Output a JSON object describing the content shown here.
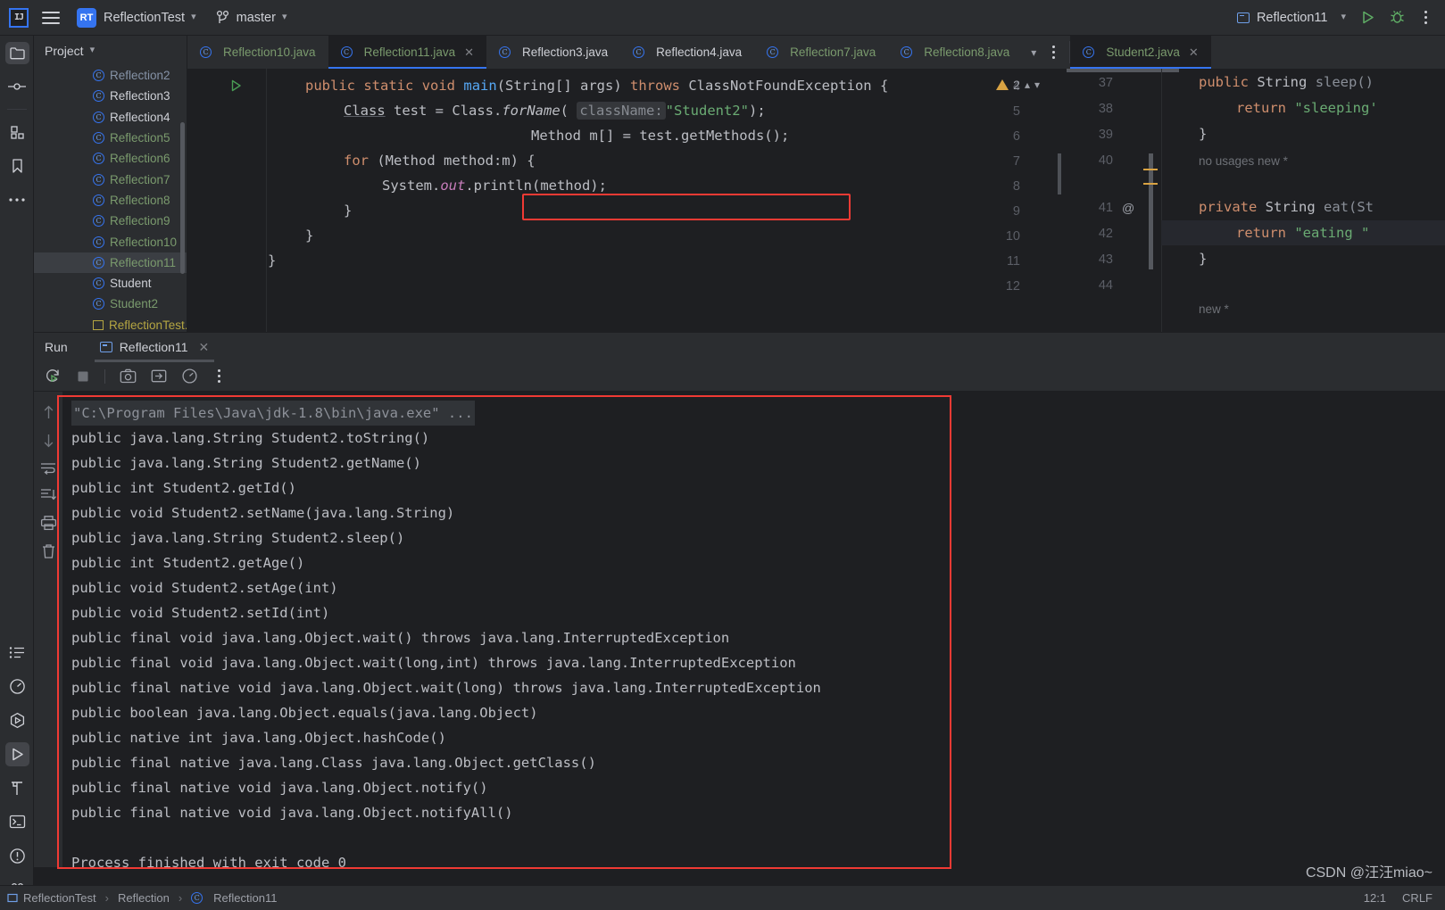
{
  "toolbar": {
    "logo_text": "IJ",
    "project_badge": "RT",
    "project_name": "ReflectionTest",
    "branch_name": "master",
    "run_config": "Reflection11",
    "icons": {
      "menu": "hamburger-icon",
      "run": "run-icon",
      "debug": "debug-icon",
      "more": "more-icon"
    }
  },
  "left_activity_bar": {
    "items": [
      {
        "name": "project-icon",
        "label": "Project"
      },
      {
        "name": "commit-icon",
        "label": "Commit"
      },
      {
        "name": "structure-icon",
        "label": "Structure"
      },
      {
        "name": "bookmarks-icon",
        "label": "Bookmarks"
      },
      {
        "name": "more-tool-windows-icon",
        "label": "More"
      }
    ],
    "bottom_items": [
      {
        "name": "todo-icon",
        "label": "TODO"
      },
      {
        "name": "profiler-icon",
        "label": "Profiler"
      },
      {
        "name": "services-icon",
        "label": "Services"
      },
      {
        "name": "run-tool-icon",
        "label": "Run"
      },
      {
        "name": "build-icon",
        "label": "Build"
      },
      {
        "name": "terminal-icon",
        "label": "Terminal"
      },
      {
        "name": "problems-icon",
        "label": "Problems"
      },
      {
        "name": "version-control-icon",
        "label": "Git"
      }
    ]
  },
  "project_panel": {
    "title": "Project",
    "tree": [
      {
        "label": "Reflection2",
        "icon": "java-class-icon",
        "color": "#8592a6",
        "selected": false
      },
      {
        "label": "Reflection3",
        "icon": "java-class-icon",
        "color": "#ced0d6",
        "selected": false
      },
      {
        "label": "Reflection4",
        "icon": "java-class-icon",
        "color": "#ced0d6",
        "selected": false
      },
      {
        "label": "Reflection5",
        "icon": "java-class-icon",
        "color": "#7a9a6d",
        "selected": false
      },
      {
        "label": "Reflection6",
        "icon": "java-class-icon",
        "color": "#7a9a6d",
        "selected": false
      },
      {
        "label": "Reflection7",
        "icon": "java-class-icon",
        "color": "#7a9a6d",
        "selected": false
      },
      {
        "label": "Reflection8",
        "icon": "java-class-icon",
        "color": "#7a9a6d",
        "selected": false
      },
      {
        "label": "Reflection9",
        "icon": "java-class-icon",
        "color": "#7a9a6d",
        "selected": false
      },
      {
        "label": "Reflection10",
        "icon": "java-class-icon",
        "color": "#7a9a6d",
        "selected": false
      },
      {
        "label": "Reflection11",
        "icon": "java-class-icon",
        "color": "#7a9a6d",
        "selected": true
      },
      {
        "label": "Student",
        "icon": "java-class-icon",
        "color": "#ced0d6",
        "selected": false
      },
      {
        "label": "Student2",
        "icon": "java-class-icon",
        "color": "#7a9a6d",
        "selected": false
      },
      {
        "label": "ReflectionTest.iml",
        "icon": "module-file-icon",
        "color": "#b5a642",
        "selected": false
      }
    ]
  },
  "editor_tabs": {
    "tabs": [
      {
        "label": "Reflection10.java",
        "active": false,
        "closable": false,
        "color": "#7a9a6d"
      },
      {
        "label": "Reflection11.java",
        "active": true,
        "closable": true,
        "color": "#7a9a6d"
      },
      {
        "label": "Reflection3.java",
        "active": false,
        "closable": false,
        "color": "#ced0d6"
      },
      {
        "label": "Reflection4.java",
        "active": false,
        "closable": false,
        "color": "#ced0d6"
      },
      {
        "label": "Reflection7.java",
        "active": false,
        "closable": false,
        "color": "#7a9a6d"
      },
      {
        "label": "Reflection8.java",
        "active": false,
        "closable": false,
        "color": "#7a9a6d"
      }
    ],
    "overflow_chevron": "chevron-down-icon",
    "tab_options": "more-icon",
    "right_split_tab": {
      "label": "Student2.java",
      "active": true,
      "closable": true,
      "color": "#7a9a6d"
    }
  },
  "editor_left": {
    "file": "Reflection11.java",
    "warning_count": "2",
    "line_numbers": [
      "4",
      "5",
      "6",
      "7",
      "8",
      "9",
      "10",
      "11",
      "12"
    ],
    "lines": [
      {
        "n": "4",
        "text": "public static void main(String[] args) throws ClassNotFoundException {"
      },
      {
        "n": "5",
        "text": "    Class test = Class.forName( className: \"Student2\");"
      },
      {
        "n": "6",
        "text": "    Method m[] = test.getMethods();"
      },
      {
        "n": "7",
        "text": "    for (Method method:m) {"
      },
      {
        "n": "8",
        "text": "        System.out.println(method);"
      },
      {
        "n": "9",
        "text": "    }"
      },
      {
        "n": "10",
        "text": "}"
      },
      {
        "n": "11",
        "text": "}"
      },
      {
        "n": "12",
        "text": ""
      }
    ],
    "param_hint": "className:",
    "highlight_box_line": "6"
  },
  "editor_right": {
    "file": "Student2.java",
    "line_numbers": [
      "37",
      "38",
      "39",
      "40",
      "41",
      "42",
      "43",
      "44"
    ],
    "lines": [
      {
        "n": "37",
        "text": "public String sleep()"
      },
      {
        "n": "38",
        "text": "    return \"sleeping\""
      },
      {
        "n": "39",
        "text": "}"
      },
      {
        "n": "40",
        "text": ""
      },
      {
        "n": "41",
        "text": "private String eat(St"
      },
      {
        "n": "42",
        "text": "    return \"eating \""
      },
      {
        "n": "43",
        "text": "}"
      },
      {
        "n": "44",
        "text": ""
      }
    ],
    "inlay_hints": [
      "no usages   new *",
      "new *"
    ],
    "annotation_marker": "@",
    "caret_line": "42"
  },
  "run_window": {
    "title": "Run",
    "tab_label": "Reflection11",
    "toolbar_icons": [
      {
        "name": "rerun-icon"
      },
      {
        "name": "stop-icon"
      },
      {
        "name": "screenshot-icon"
      },
      {
        "name": "export-icon"
      },
      {
        "name": "profile-icon"
      },
      {
        "name": "more-icon"
      }
    ],
    "gutter_icons": [
      {
        "name": "scroll-up-icon"
      },
      {
        "name": "scroll-down-icon"
      },
      {
        "name": "soft-wrap-icon"
      },
      {
        "name": "scroll-to-end-icon"
      },
      {
        "name": "print-icon"
      },
      {
        "name": "clear-all-icon"
      }
    ],
    "console_command": "\"C:\\Program Files\\Java\\jdk-1.8\\bin\\java.exe\" ...",
    "console_lines": [
      "public java.lang.String Student2.toString()",
      "public java.lang.String Student2.getName()",
      "public int Student2.getId()",
      "public void Student2.setName(java.lang.String)",
      "public java.lang.String Student2.sleep()",
      "public int Student2.getAge()",
      "public void Student2.setAge(int)",
      "public void Student2.setId(int)",
      "public final void java.lang.Object.wait() throws java.lang.InterruptedException",
      "public final void java.lang.Object.wait(long,int) throws java.lang.InterruptedException",
      "public final native void java.lang.Object.wait(long) throws java.lang.InterruptedException",
      "public boolean java.lang.Object.equals(java.lang.Object)",
      "public native int java.lang.Object.hashCode()",
      "public final native java.lang.Class java.lang.Object.getClass()",
      "public final native void java.lang.Object.notify()",
      "public final native void java.lang.Object.notifyAll()",
      "",
      "Process finished with exit code 0"
    ]
  },
  "status_bar": {
    "breadcrumb": [
      "ReflectionTest",
      "Reflection",
      "Reflection11"
    ],
    "caret_position": "12:1",
    "line_separator": "CRLF"
  },
  "watermark": "CSDN @汪汪miao~",
  "colors": {
    "accent": "#3574f0",
    "highlight_red": "#f03a34",
    "string_green": "#6aab73",
    "keyword_orange": "#cf8e6d",
    "method_blue": "#56a8f5",
    "warning_yellow": "#d9a343",
    "run_green": "#499c54",
    "bg_editor": "#1e1f22",
    "bg_panel": "#2b2d30"
  }
}
